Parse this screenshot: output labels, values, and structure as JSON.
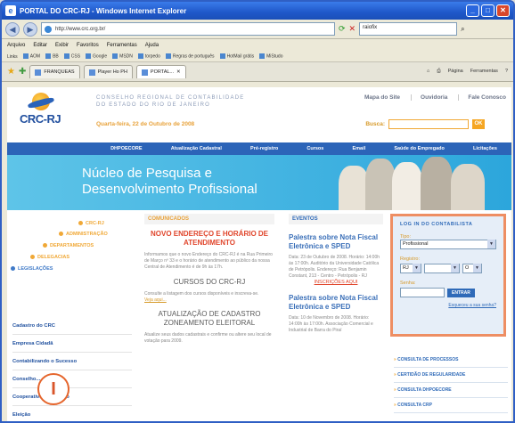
{
  "window": {
    "title": "PORTAL DO CRC-RJ - Windows Internet Explorer"
  },
  "address": {
    "url": "http://www.crc.org.br/",
    "search_value": "raiofix"
  },
  "menu": [
    "Arquivo",
    "Editar",
    "Exibir",
    "Favoritos",
    "Ferramentas",
    "Ajuda"
  ],
  "links": [
    "Links",
    "AOM",
    "BB",
    "CSS",
    "Google",
    "MSDN",
    "torpedo",
    "Regras de português",
    "HotMail grátis",
    "MiStudo"
  ],
  "tabs": [
    "FRANQUEAS",
    "Player Ho PH",
    "PORTAL..."
  ],
  "tools": [
    "Página",
    "Ferramentas"
  ],
  "site": {
    "logo": "CRC-RJ",
    "org_line1": "CONSELHO REGIONAL DE CONTABILIDADE",
    "org_line2": "DO ESTADO DO RIO DE JANEIRO",
    "date": "Quarta-feira, 22 de Outubro de 2008",
    "top_links": [
      "Mapa do Site",
      "Ouvidoria",
      "Fale Conosco"
    ],
    "search_label": "Busca:",
    "search_button": "OK",
    "nav": [
      "DHPOECORE",
      "Atualização Cadastral",
      "Pré-registro",
      "Cursos",
      "Email",
      "Saúde do Empregado",
      "Licitações"
    ],
    "banner_line1": "Núcleo de Pesquisa e",
    "banner_line2": "Desenvolvimento Profissional"
  },
  "leftnav": {
    "orbit": [
      "CRC-RJ",
      "ADMINISTRAÇÃO",
      "DEPARTAMENTOS",
      "DELEGACIAS",
      "LEGISLAÇÕES"
    ],
    "links": [
      "Cadastro do CRC",
      "Empresa Cidadã",
      "Contabilizando o Sucesso",
      "Conselho...",
      "Cooperativa de Crédito",
      "Eleição"
    ],
    "marker": "I"
  },
  "comunicados": {
    "header": "COMUNICADOS",
    "headline": "NOVO ENDEREÇO E HORÁRIO DE ATENDIMENTO",
    "text": "Informamos que o novo Endereço do CRC-RJ é na Rua Primeiro de Março nº 33 e o horário de atendimento ao público da nossa Central de Atendimento é de 9h às 17h.",
    "cursos_title": "CURSOS DO CRC-RJ",
    "cursos_text": "Consulte a listagem dos cursos disponíveis e inscreva-se.",
    "more": "Veja aqui...",
    "atual_title": "ATUALIZAÇÃO DE CADASTRO ZONEAMENTO ELEITORAL",
    "atual_text": "Atualize seus dados cadastrais e confirme ou altere seu local de votação para 2009."
  },
  "eventos": {
    "header": "EVENTOS",
    "ev1_title": "Palestra sobre Nota Fiscal Eletrônica e SPED",
    "ev1_text": "Data: 23 de Outubro de 2008. Horário: 14:00h às 17:00h. Auditório da Universidade Católica de Petrópolis. Endereço: Rua Benjamin Constant, 213 - Centro - Petrópolis - RJ",
    "ev1_link": "INSCRIÇÕES AQUI",
    "ev2_title": "Palestra sobre Nota Fiscal Eletrônica e SPED",
    "ev2_text": "Data: 10 de Novembro de 2008. Horário: 14:00h às 17:00h. Associação Comercial e Industrial de Barra do Piraí"
  },
  "login": {
    "header": "LOG IN DO CONTABILISTA",
    "tipo_label": "Tipo:",
    "tipo_value": "Profissional",
    "registro_label": "Registro:",
    "uf_value": "RJ",
    "cat_value": "O",
    "senha_label": "Senha:",
    "entrar": "ENTRAR",
    "esqueceu": "Esqueceu a sua senha?"
  },
  "quicklinks": [
    "CONSULTA DE PROCESSOS",
    "CERTIDÃO DE REGULARIDADE",
    "CONSULTA DHPOECORE",
    "CONSULTA CRP"
  ]
}
